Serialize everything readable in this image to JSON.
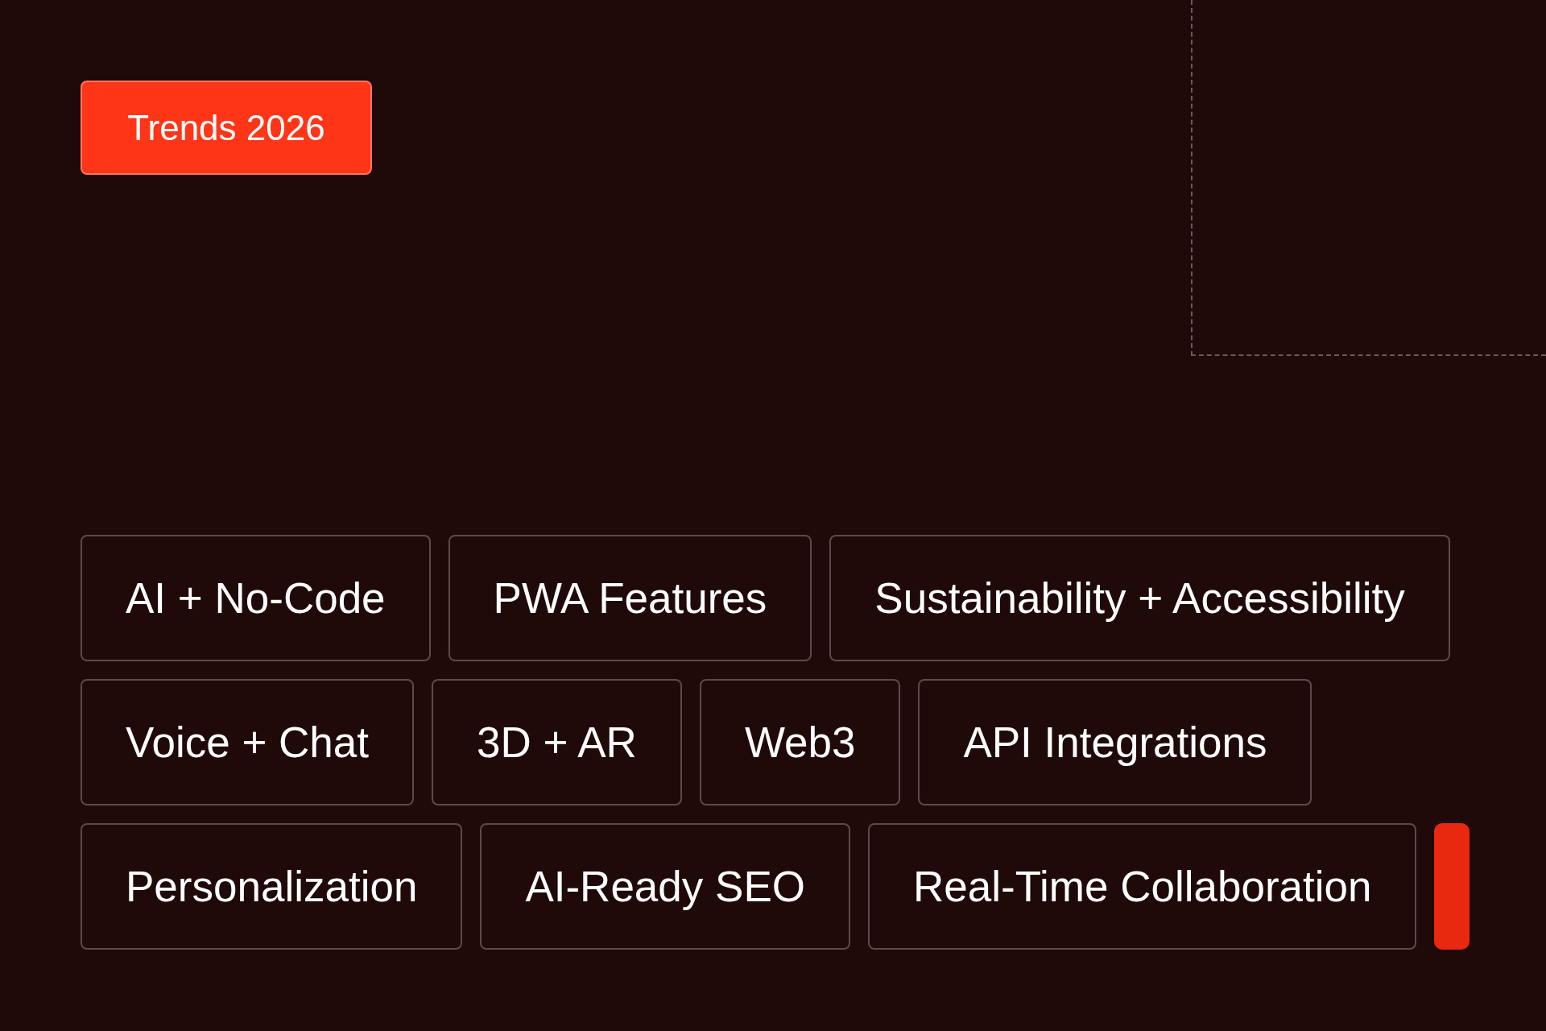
{
  "badge": {
    "label": "Trends 2026"
  },
  "tag_rows": [
    {
      "tags": [
        "AI + No-Code",
        "PWA Features",
        "Sustainability + Accessibility"
      ]
    },
    {
      "tags": [
        "Voice + Chat",
        "3D + AR",
        "Web3",
        "API Integrations"
      ]
    },
    {
      "tags": [
        "Personalization",
        "AI-Ready SEO",
        "Real-Time Collaboration"
      ],
      "cursor": true
    }
  ]
}
